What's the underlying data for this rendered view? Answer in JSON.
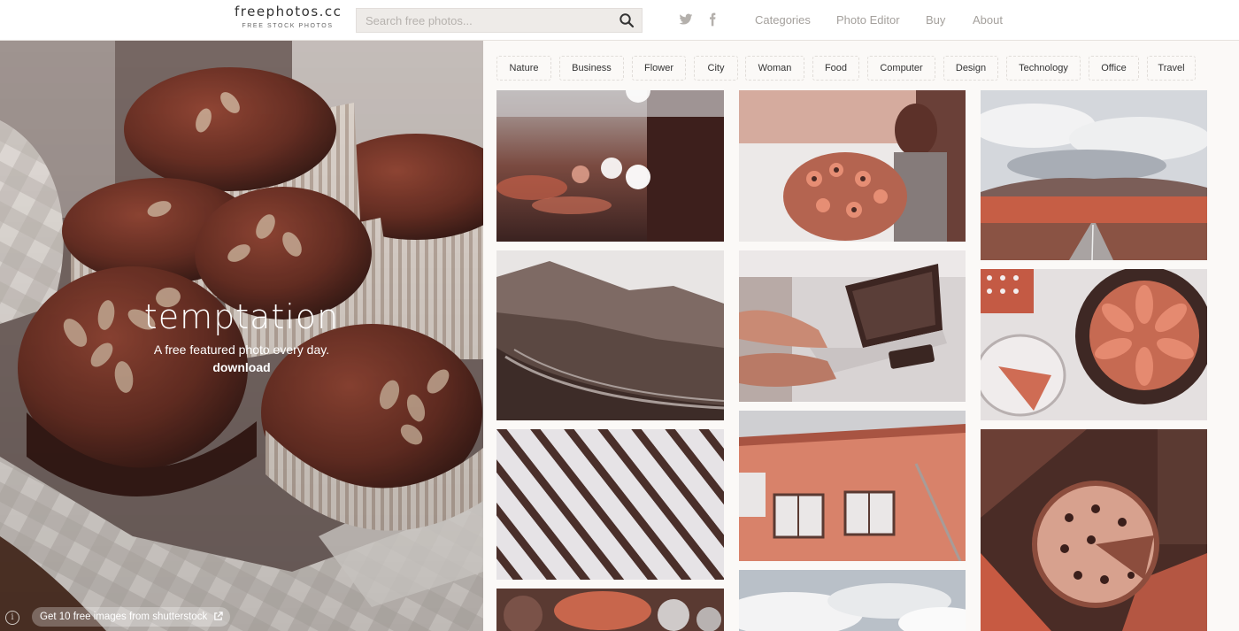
{
  "header": {
    "logo_name": "freephotos.cc",
    "logo_tagline": "FREE STOCK PHOTOS",
    "search_placeholder": "Search free photos...",
    "social": [
      "twitter-icon",
      "facebook-icon"
    ],
    "nav": [
      "Categories",
      "Photo Editor",
      "Buy",
      "About"
    ]
  },
  "hero": {
    "title": "temptation",
    "subtitle": "A free featured photo every day.",
    "download_label": "download",
    "info_icon": "i",
    "shutterstock_label": "Get 10 free images from shutterstock"
  },
  "categories": [
    "Nature",
    "Business",
    "Flower",
    "City",
    "Woman",
    "Food",
    "Computer",
    "Design",
    "Technology",
    "Office",
    "Travel"
  ],
  "colors": {
    "accent": "#c2553a",
    "dark_brown": "#3f2420",
    "header_bg": "#ffffff",
    "page_bg": "#fbf9f7"
  },
  "photos": [
    {
      "subject": "city-lights-bokeh"
    },
    {
      "subject": "woman-with-flowers"
    },
    {
      "subject": "road-landscape"
    },
    {
      "subject": "railway-valley"
    },
    {
      "subject": "laptop-typing"
    },
    {
      "subject": "fruit-tart"
    },
    {
      "subject": "wooden-slats"
    },
    {
      "subject": "building-windows"
    },
    {
      "subject": "pizza-table"
    },
    {
      "subject": "table-cups"
    },
    {
      "subject": "clouds-sky"
    }
  ]
}
